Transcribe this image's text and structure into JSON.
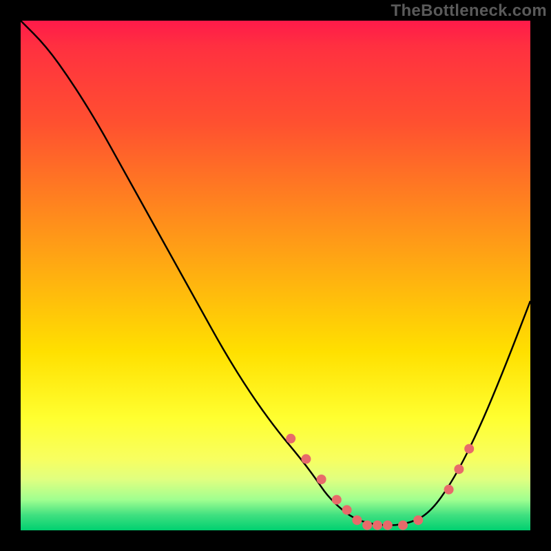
{
  "watermark": "TheBottleneck.com",
  "chart_data": {
    "type": "line",
    "title": "",
    "xlabel": "",
    "ylabel": "",
    "xlim": [
      0,
      100
    ],
    "ylim": [
      0,
      100
    ],
    "grid": false,
    "legend": false,
    "series": [
      {
        "name": "bottleneck-curve",
        "color": "#000000",
        "x": [
          0,
          5,
          10,
          15,
          20,
          25,
          30,
          35,
          40,
          45,
          50,
          55,
          58,
          60,
          63,
          66,
          70,
          75,
          80,
          85,
          90,
          95,
          100
        ],
        "y": [
          100,
          95,
          88,
          80,
          71,
          62,
          53,
          44,
          35,
          27,
          20,
          14,
          10,
          7,
          4,
          2,
          1,
          1,
          3,
          10,
          20,
          32,
          45
        ]
      }
    ],
    "markers": {
      "name": "highlighted-points",
      "color": "#e86a6a",
      "x": [
        53,
        56,
        59,
        62,
        64,
        66,
        68,
        70,
        72,
        75,
        78,
        84,
        86,
        88
      ],
      "y": [
        18,
        14,
        10,
        6,
        4,
        2,
        1,
        1,
        1,
        1,
        2,
        8,
        12,
        16
      ]
    }
  }
}
